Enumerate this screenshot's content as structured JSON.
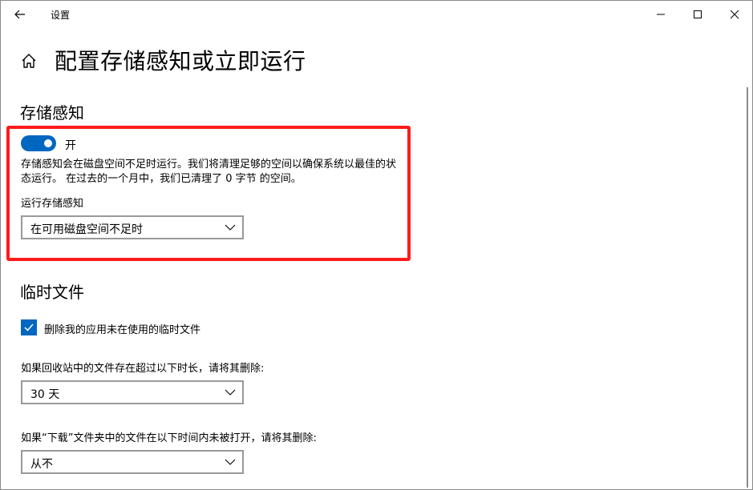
{
  "window": {
    "title": "设置",
    "icons": {
      "back": "back-arrow-icon",
      "minimize": "minimize-icon",
      "maximize": "maximize-icon",
      "close": "close-icon"
    }
  },
  "page": {
    "title": "配置存储感知或立即运行",
    "home_icon": "home-icon"
  },
  "storage_sense": {
    "heading": "存储感知",
    "toggle_state": "开",
    "toggle_on": true,
    "description": "存储感知会在磁盘空间不足时运行。我们将清理足够的空间以确保系统以最佳的状态运行。 在过去的一个月中，我们已清理了 0 字节 的空间。",
    "run_label": "运行存储感知",
    "run_value": "在可用磁盘空间不足时"
  },
  "temp_files": {
    "heading": "临时文件",
    "delete_temp_label": "删除我的应用未在使用的临时文件",
    "delete_temp_checked": true,
    "recycle_label": "如果回收站中的文件存在超过以下时长，请将其删除:",
    "recycle_value": "30 天",
    "downloads_label": "如果“下载”文件夹中的文件在以下时间内未被打开，请将其删除:",
    "downloads_value": "从不"
  },
  "colors": {
    "accent": "#0067c0",
    "highlight": "#ff1b1b"
  }
}
